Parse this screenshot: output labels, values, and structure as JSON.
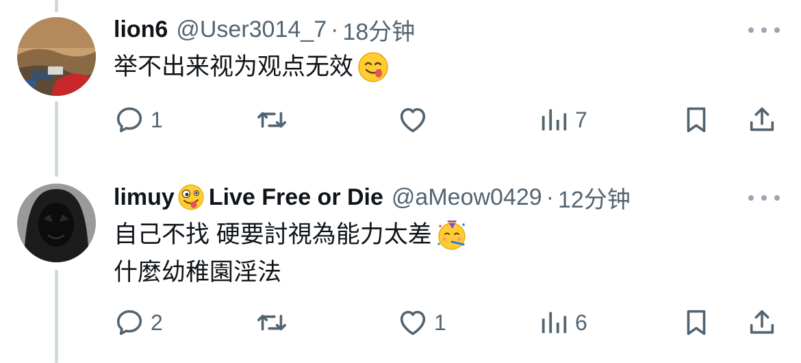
{
  "tweets": [
    {
      "display_name": "lion6",
      "handle": "@User3014_7",
      "separator": "·",
      "time": "18分钟",
      "text_lines": [
        "举不出来视为观点无效"
      ],
      "text_emoji": "face-savoring-food-emoji",
      "actions": {
        "reply_count": "1",
        "retweet_count": "",
        "like_count": "",
        "views_count": "7"
      }
    },
    {
      "display_name": "limuy",
      "name_emoji": "zany-face-emoji",
      "display_name_suffix": "Live Free or Die",
      "handle": "@aMeow0429",
      "separator": "·",
      "time": "12分钟",
      "text_lines": [
        "自己不找 硬要討視為能力太差",
        "什麼幼稚園淫法"
      ],
      "text_emoji": "partying-face-emoji",
      "actions": {
        "reply_count": "2",
        "retweet_count": "",
        "like_count": "1",
        "views_count": "6"
      }
    }
  ],
  "colors": {
    "text": "#0f1419",
    "secondary": "#536471",
    "thread_line": "#cfd9de",
    "more_dots": "#9aa5b0"
  },
  "icons": [
    "reply-icon",
    "retweet-icon",
    "like-icon",
    "views-icon",
    "bookmark-icon",
    "share-icon",
    "more-icon"
  ]
}
